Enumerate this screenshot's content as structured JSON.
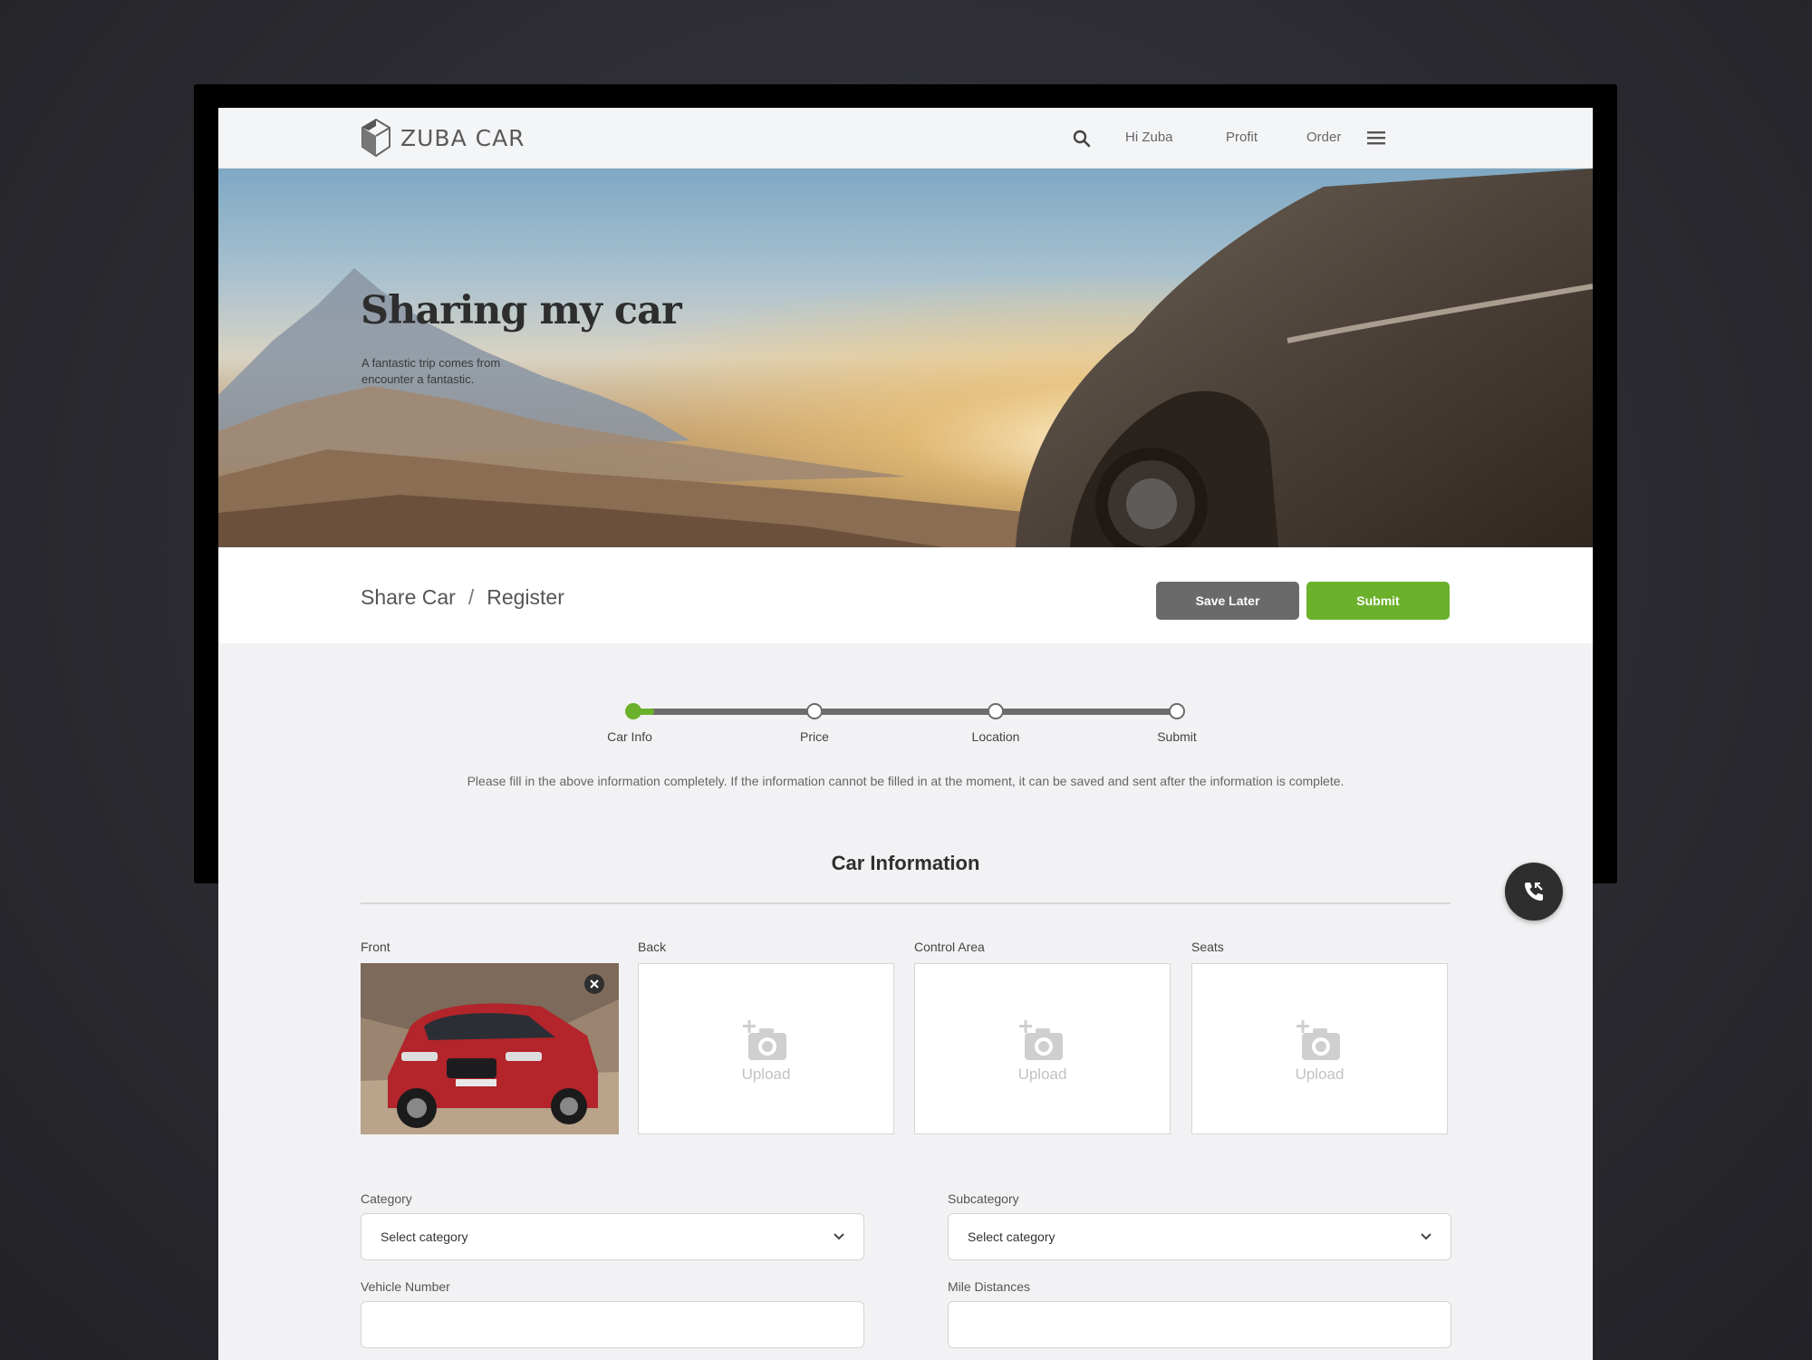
{
  "app": {
    "brand": "ZUBA CAR",
    "brand_icon": "zuba-cube-logo"
  },
  "nav": {
    "search_icon": "search-icon",
    "greeting": "Hi Zuba",
    "profit": "Profit",
    "order": "Order",
    "menu_icon": "hamburger-menu-icon"
  },
  "hero": {
    "title": "Sharing my car",
    "subtitle": "A fantastic trip comes from encounter a fantastic."
  },
  "breadcrumb": {
    "parent": "Share Car",
    "separator": "/",
    "current": "Register"
  },
  "actions": {
    "save_later": "Save Later",
    "submit": "Submit"
  },
  "progress": {
    "current_step": 1,
    "fill_fraction": 0.04,
    "steps": [
      "Car Info",
      "Price",
      "Location",
      "Submit"
    ]
  },
  "note": "Please fill in the above information completely.  If the information cannot be filled in at the moment, it can be saved and sent after the information is complete.",
  "section": {
    "title": "Car Information"
  },
  "photos": {
    "front": {
      "label": "Front",
      "uploaded": true
    },
    "back": {
      "label": "Back",
      "upload_text": "Upload"
    },
    "control_area": {
      "label": "Control Area",
      "upload_text": "Upload"
    },
    "seats": {
      "label": "Seats",
      "upload_text": "Upload"
    }
  },
  "form": {
    "category": {
      "label": "Category",
      "value": "Select category"
    },
    "subcategory": {
      "label": "Subcategory",
      "value": "Select category"
    },
    "vehicle_number": {
      "label": "Vehicle Number",
      "value": ""
    },
    "mile_distances": {
      "label": "Mile Distances",
      "value": ""
    }
  },
  "colors": {
    "accent_green": "#6bb12b",
    "button_gray": "#6a6a6a",
    "dark": "#2e2e2e"
  },
  "floating": {
    "call_icon": "phone-call-icon"
  }
}
